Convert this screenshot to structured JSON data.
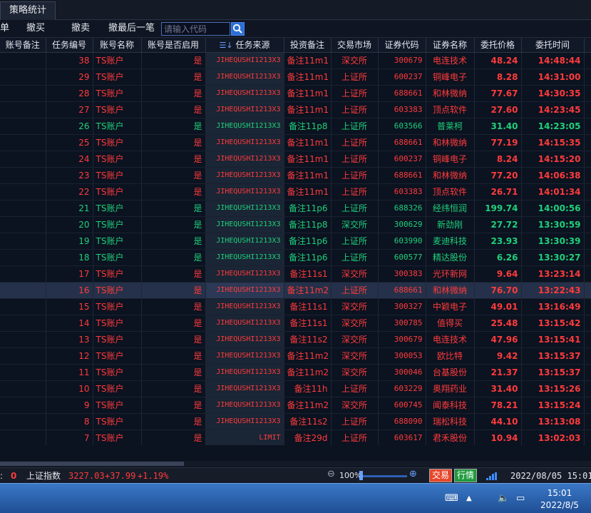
{
  "tabs": [
    {
      "label": "策略统计"
    }
  ],
  "toolbar": {
    "buttons": [
      {
        "label": "单"
      },
      {
        "label": "撤买"
      },
      {
        "label": "撤卖"
      },
      {
        "label": "撤最后一笔"
      }
    ],
    "search_placeholder": "请输入代码"
  },
  "table": {
    "columns": [
      "账号备注",
      "任务编号",
      "账号名称",
      "账号是否启用",
      "任务来源",
      "投资备注",
      "交易市场",
      "证券代码",
      "证券名称",
      "委托价格",
      "委托时间"
    ],
    "rows": [
      {
        "task_id": "38",
        "account": "TS账户",
        "enabled": "是",
        "source": "JIHEQUSHI1213X3",
        "memo": "备注11m1",
        "market": "深交所",
        "code": "300679",
        "name": "电连技术",
        "price": "48.24",
        "time": "14:48:44",
        "color": "red",
        "selected": false
      },
      {
        "task_id": "29",
        "account": "TS账户",
        "enabled": "是",
        "source": "JIHEQUSHI1213X3",
        "memo": "备注11m1",
        "market": "上证所",
        "code": "600237",
        "name": "铜峰电子",
        "price": "8.28",
        "time": "14:31:00",
        "color": "red",
        "selected": false
      },
      {
        "task_id": "28",
        "account": "TS账户",
        "enabled": "是",
        "source": "JIHEQUSHI1213X3",
        "memo": "备注11m1",
        "market": "上证所",
        "code": "688661",
        "name": "和林微纳",
        "price": "77.67",
        "time": "14:30:35",
        "color": "red",
        "selected": false
      },
      {
        "task_id": "27",
        "account": "TS账户",
        "enabled": "是",
        "source": "JIHEQUSHI1213X3",
        "memo": "备注11m1",
        "market": "上证所",
        "code": "603383",
        "name": "顶点软件",
        "price": "27.60",
        "time": "14:23:45",
        "color": "red",
        "selected": false
      },
      {
        "task_id": "26",
        "account": "TS账户",
        "enabled": "是",
        "source": "JIHEQUSHI1213X3",
        "memo": "备注11p8",
        "market": "上证所",
        "code": "603566",
        "name": "普莱柯",
        "price": "31.40",
        "time": "14:23:05",
        "color": "green",
        "selected": false
      },
      {
        "task_id": "25",
        "account": "TS账户",
        "enabled": "是",
        "source": "JIHEQUSHI1213X3",
        "memo": "备注11m1",
        "market": "上证所",
        "code": "688661",
        "name": "和林微纳",
        "price": "77.19",
        "time": "14:15:35",
        "color": "red",
        "selected": false
      },
      {
        "task_id": "24",
        "account": "TS账户",
        "enabled": "是",
        "source": "JIHEQUSHI1213X3",
        "memo": "备注11m1",
        "market": "上证所",
        "code": "600237",
        "name": "铜峰电子",
        "price": "8.24",
        "time": "14:15:20",
        "color": "red",
        "selected": false
      },
      {
        "task_id": "23",
        "account": "TS账户",
        "enabled": "是",
        "source": "JIHEQUSHI1213X3",
        "memo": "备注11m1",
        "market": "上证所",
        "code": "688661",
        "name": "和林微纳",
        "price": "77.20",
        "time": "14:06:38",
        "color": "red",
        "selected": false
      },
      {
        "task_id": "22",
        "account": "TS账户",
        "enabled": "是",
        "source": "JIHEQUSHI1213X3",
        "memo": "备注11m1",
        "market": "上证所",
        "code": "603383",
        "name": "顶点软件",
        "price": "26.71",
        "time": "14:01:34",
        "color": "red",
        "selected": false
      },
      {
        "task_id": "21",
        "account": "TS账户",
        "enabled": "是",
        "source": "JIHEQUSHI1213X3",
        "memo": "备注11p6",
        "market": "上证所",
        "code": "688326",
        "name": "经纬恒润",
        "price": "199.74",
        "time": "14:00:56",
        "color": "green",
        "selected": false
      },
      {
        "task_id": "20",
        "account": "TS账户",
        "enabled": "是",
        "source": "JIHEQUSHI1213X3",
        "memo": "备注11p8",
        "market": "深交所",
        "code": "300629",
        "name": "新劲刚",
        "price": "27.72",
        "time": "13:30:59",
        "color": "green",
        "selected": false
      },
      {
        "task_id": "19",
        "account": "TS账户",
        "enabled": "是",
        "source": "JIHEQUSHI1213X3",
        "memo": "备注11p6",
        "market": "上证所",
        "code": "603990",
        "name": "麦迪科技",
        "price": "23.93",
        "time": "13:30:39",
        "color": "green",
        "selected": false
      },
      {
        "task_id": "18",
        "account": "TS账户",
        "enabled": "是",
        "source": "JIHEQUSHI1213X3",
        "memo": "备注11p6",
        "market": "上证所",
        "code": "600577",
        "name": "精达股份",
        "price": "6.26",
        "time": "13:30:27",
        "color": "green",
        "selected": false
      },
      {
        "task_id": "17",
        "account": "TS账户",
        "enabled": "是",
        "source": "JIHEQUSHI1213X3",
        "memo": "备注11s1",
        "market": "深交所",
        "code": "300383",
        "name": "光环新网",
        "price": "9.64",
        "time": "13:23:14",
        "color": "red",
        "selected": false
      },
      {
        "task_id": "16",
        "account": "TS账户",
        "enabled": "是",
        "source": "JIHEQUSHI1213X3",
        "memo": "备注11m2",
        "market": "上证所",
        "code": "688661",
        "name": "和林微纳",
        "price": "76.70",
        "time": "13:22:43",
        "color": "red",
        "selected": true
      },
      {
        "task_id": "15",
        "account": "TS账户",
        "enabled": "是",
        "source": "JIHEQUSHI1213X3",
        "memo": "备注11s1",
        "market": "深交所",
        "code": "300327",
        "name": "中颖电子",
        "price": "49.01",
        "time": "13:16:49",
        "color": "red",
        "selected": false
      },
      {
        "task_id": "14",
        "account": "TS账户",
        "enabled": "是",
        "source": "JIHEQUSHI1213X3",
        "memo": "备注11s1",
        "market": "深交所",
        "code": "300785",
        "name": "值得买",
        "price": "25.48",
        "time": "13:15:42",
        "color": "red",
        "selected": false
      },
      {
        "task_id": "13",
        "account": "TS账户",
        "enabled": "是",
        "source": "JIHEQUSHI1213X3",
        "memo": "备注11s2",
        "market": "深交所",
        "code": "300679",
        "name": "电连技术",
        "price": "47.96",
        "time": "13:15:41",
        "color": "red",
        "selected": false
      },
      {
        "task_id": "12",
        "account": "TS账户",
        "enabled": "是",
        "source": "JIHEQUSHI1213X3",
        "memo": "备注11m2",
        "market": "深交所",
        "code": "300053",
        "name": "欧比特",
        "price": "9.42",
        "time": "13:15:37",
        "color": "red",
        "selected": false
      },
      {
        "task_id": "11",
        "account": "TS账户",
        "enabled": "是",
        "source": "JIHEQUSHI1213X3",
        "memo": "备注11m2",
        "market": "深交所",
        "code": "300046",
        "name": "台基股份",
        "price": "21.37",
        "time": "13:15:37",
        "color": "red",
        "selected": false
      },
      {
        "task_id": "10",
        "account": "TS账户",
        "enabled": "是",
        "source": "JIHEQUSHI1213X3",
        "memo": "备注11h",
        "market": "上证所",
        "code": "603229",
        "name": "奥翔药业",
        "price": "31.40",
        "time": "13:15:26",
        "color": "red",
        "selected": false
      },
      {
        "task_id": "9",
        "account": "TS账户",
        "enabled": "是",
        "source": "JIHEQUSHI1213X3",
        "memo": "备注11m2",
        "market": "深交所",
        "code": "600745",
        "name": "闻泰科技",
        "price": "78.21",
        "time": "13:15:24",
        "color": "red",
        "selected": false
      },
      {
        "task_id": "8",
        "account": "TS账户",
        "enabled": "是",
        "source": "JIHEQUSHI1213X3",
        "memo": "备注11s2",
        "market": "上证所",
        "code": "688090",
        "name": "瑞松科技",
        "price": "44.10",
        "time": "13:13:08",
        "color": "red",
        "selected": false
      },
      {
        "task_id": "7",
        "account": "TS账户",
        "enabled": "是",
        "source": "LIMIT",
        "memo": "备注29d",
        "market": "上证所",
        "code": "603617",
        "name": "君禾股份",
        "price": "10.94",
        "time": "13:02:03",
        "color": "red",
        "selected": false
      }
    ]
  },
  "statusbar": {
    "prefix": ":",
    "count": "0",
    "index_name": "上证指数",
    "index_value": "3227.03",
    "index_change": "+37.99",
    "index_pct": "+1.19%",
    "zoom": "100%",
    "trade_btn": "交易",
    "quote_btn": "行情",
    "datetime": "2022/08/05 15:01:02"
  },
  "taskbar": {
    "time": "15:01",
    "date": "2022/8/5"
  },
  "icons": {
    "search": "search-icon",
    "sort": "sort-list-icon",
    "zoom_out": "zoom-out-icon",
    "zoom_in": "zoom-in-icon",
    "signal": "signal-icon",
    "keyboard": "keyboard-icon",
    "tray_up": "tray-expand-icon",
    "volume": "volume-icon",
    "network": "network-icon"
  },
  "colors": {
    "buy": "#ff3b3b",
    "sell": "#1fd07a",
    "trade_btn": "#e8462a",
    "quote_btn": "#1f9a3e"
  }
}
